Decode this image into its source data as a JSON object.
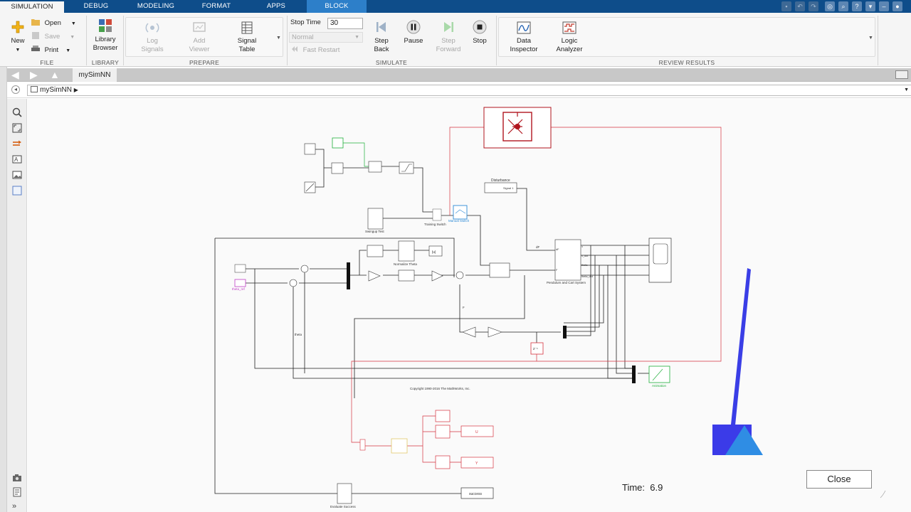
{
  "tabs": [
    {
      "label": "SIMULATION"
    },
    {
      "label": "DEBUG"
    },
    {
      "label": "MODELING"
    },
    {
      "label": "FORMAT"
    },
    {
      "label": "APPS"
    },
    {
      "label": "BLOCK"
    }
  ],
  "ribbon": {
    "file": {
      "section": "FILE",
      "new": "New",
      "open": "Open",
      "save": "Save",
      "print": "Print"
    },
    "library": {
      "section": "LIBRARY",
      "browser_line1": "Library",
      "browser_line2": "Browser"
    },
    "prepare": {
      "section": "PREPARE",
      "log_line1": "Log",
      "log_line2": "Signals",
      "add_line1": "Add",
      "add_line2": "Viewer",
      "signal_line1": "Signal",
      "signal_line2": "Table"
    },
    "simulate": {
      "section": "SIMULATE",
      "stop_time_label": "Stop Time",
      "stop_time_value": "30",
      "mode": "Normal",
      "fast_restart": "Fast Restart",
      "step_back_line1": "Step",
      "step_back_line2": "Back",
      "pause": "Pause",
      "step_fwd_line1": "Step",
      "step_fwd_line2": "Forward",
      "stop": "Stop"
    },
    "review": {
      "section": "REVIEW RESULTS",
      "data_line1": "Data",
      "data_line2": "Inspector",
      "logic_line1": "Logic",
      "logic_line2": "Analyzer"
    }
  },
  "nav": {
    "file_tab": "mySimNN"
  },
  "breadcrumb": {
    "model": "mySimNN"
  },
  "diagram": {
    "disturbance": "Disturbance",
    "swingup": "Swingup Test",
    "training_switch": "Training Switch",
    "manual_switch": "Manual Switch",
    "normalize_theta": "Normalize Theta",
    "pendulum": "Pendulum and Cart System",
    "animation": "Animation",
    "copyright": "Copyright 1990-2016 The MathWorks, Inc.",
    "evaluate": "Evaluate Success",
    "out_u": "U",
    "out_y": "Y",
    "out_success": "success",
    "theta_ref": "theta_ref",
    "theta": "theta",
    "dF": "dF",
    "F": "F",
    "in_F": "F",
    "x_dot": "x_dot",
    "x": "x",
    "theta_port": "theta",
    "theta_dot": "theta_dot",
    "signal": "Signal 1",
    "abs": "|u|",
    "zinv": "z⁻¹"
  },
  "status": {
    "time_label": "Time:",
    "time_value": "6.9"
  },
  "close_label": "Close",
  "colors": {
    "tabbar": "#0e4d8a",
    "block_tab": "#2d7fc9",
    "nn_block": "#b0151e",
    "pendulum_rod": "#3a3ee6",
    "pendulum_cart": "#3b3be8",
    "pendulum_triangle": "#2f8de4",
    "green_block": "#1fae3b",
    "magenta_block": "#c03ec6"
  }
}
